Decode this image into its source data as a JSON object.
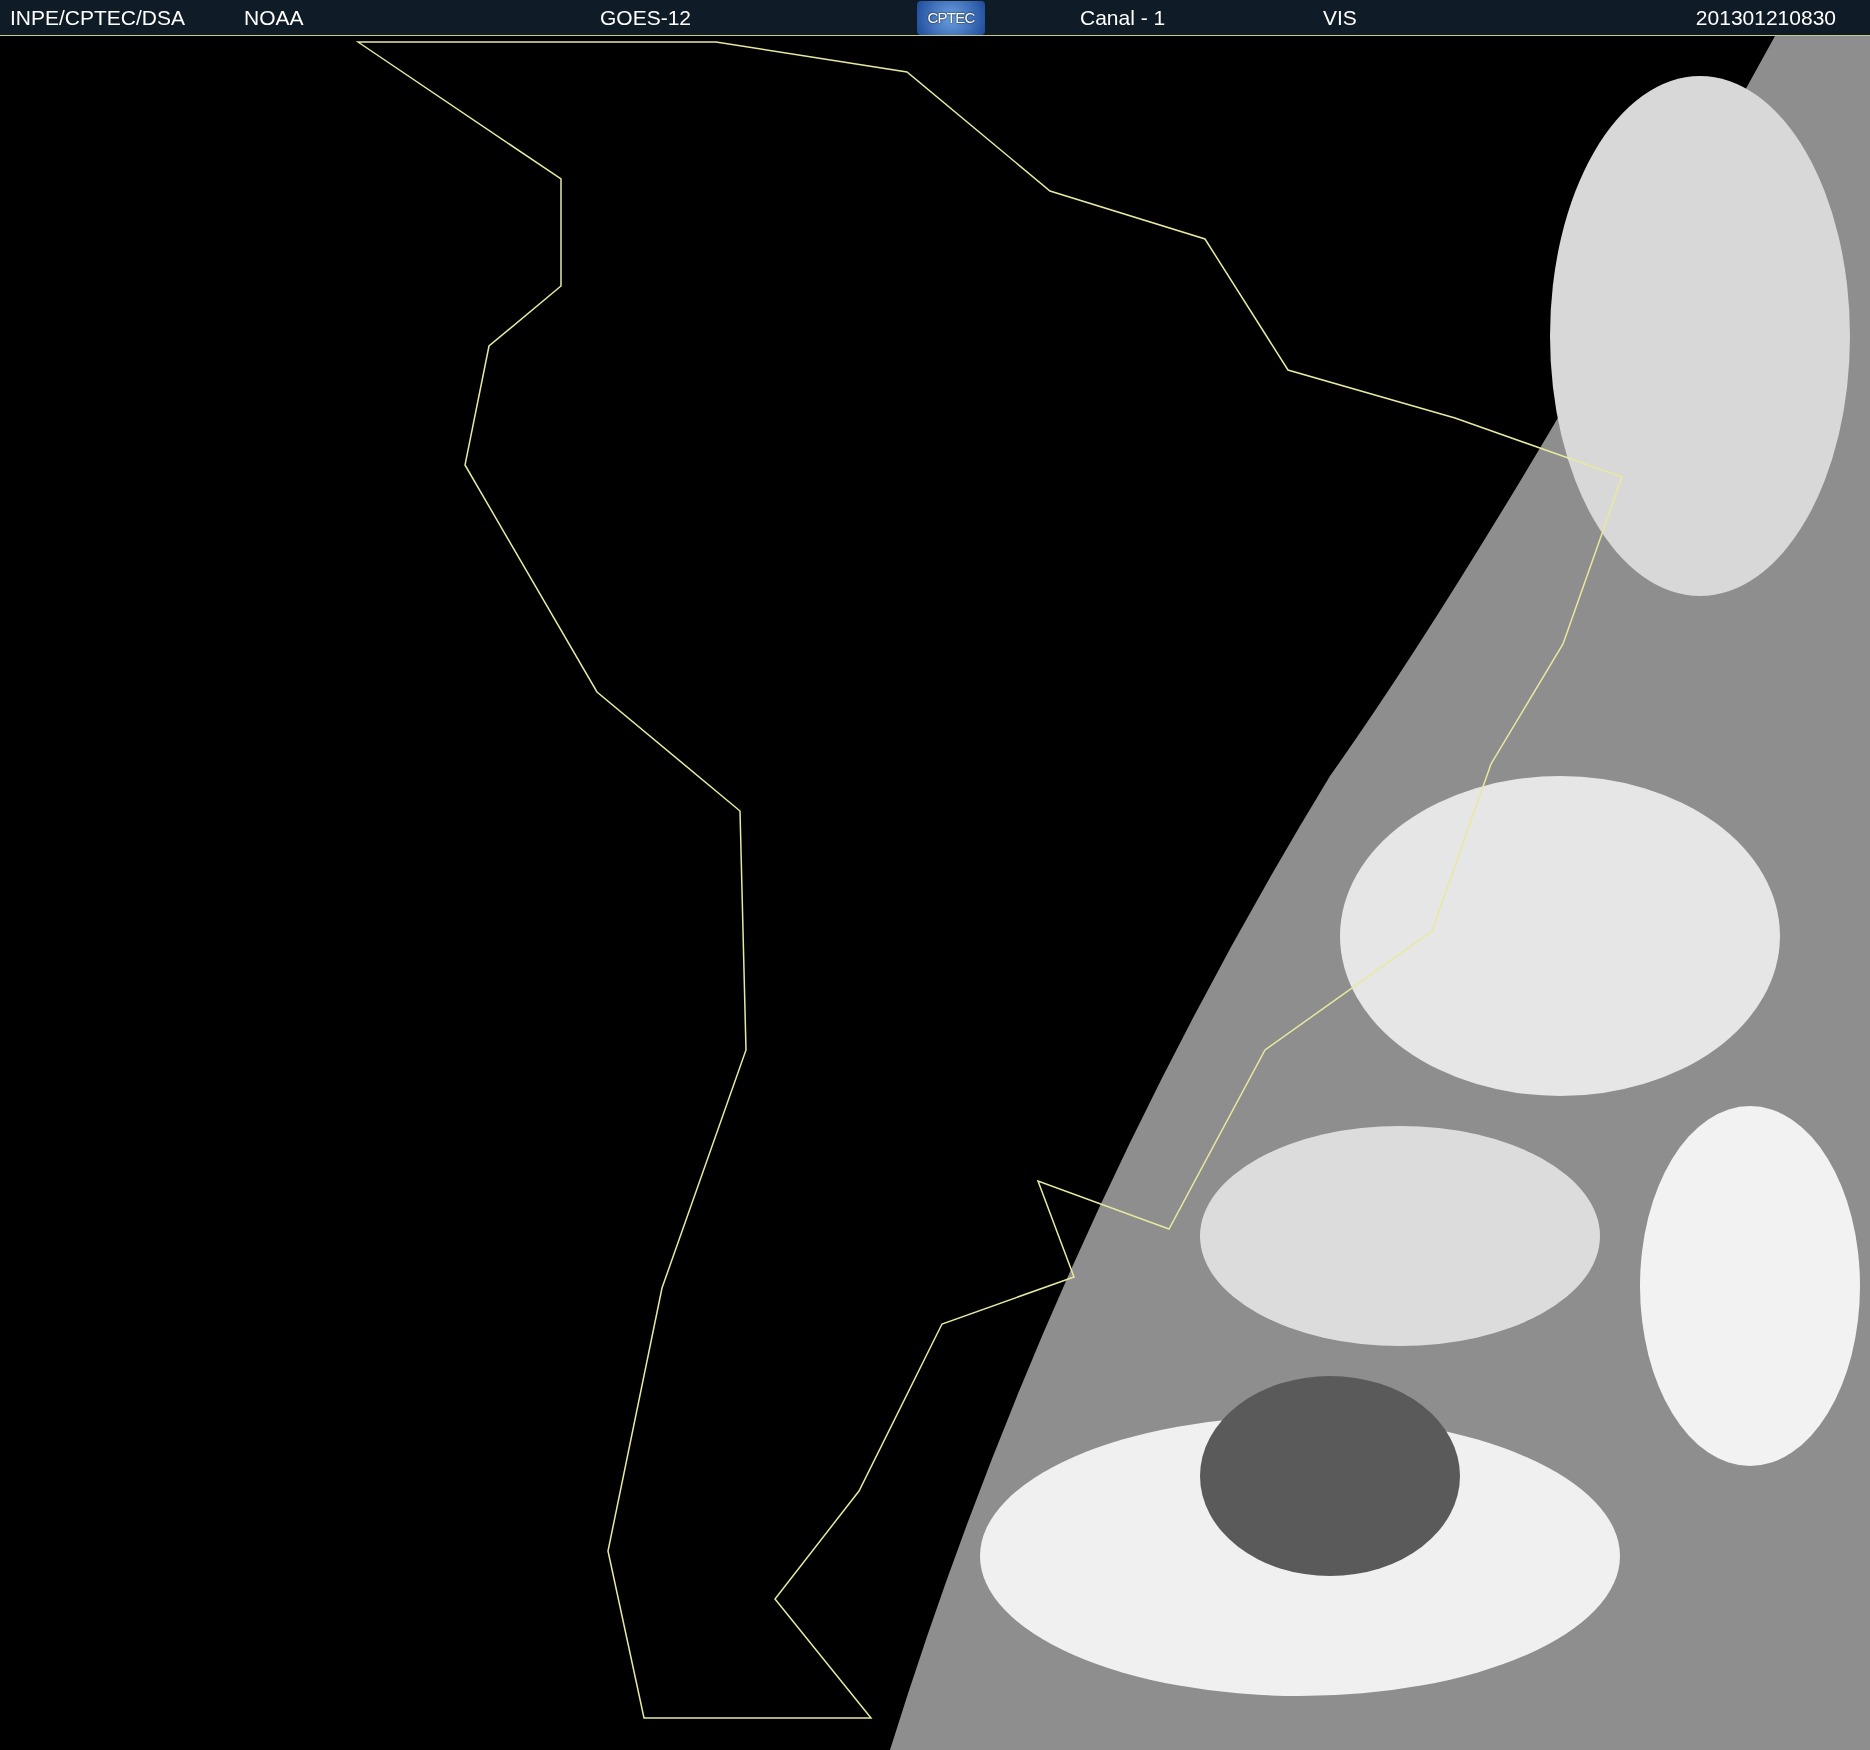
{
  "header": {
    "items": [
      {
        "kind": "text",
        "text": "INPE/CPTEC/DSA"
      },
      {
        "kind": "text",
        "text": "NOAA"
      },
      {
        "kind": "text",
        "text": "GOES-12"
      },
      {
        "kind": "logo",
        "text": "CPTEC"
      },
      {
        "kind": "text",
        "text": "Canal - 1"
      },
      {
        "kind": "text",
        "text": "VIS"
      },
      {
        "kind": "text",
        "text": "201301210830"
      }
    ]
  }
}
